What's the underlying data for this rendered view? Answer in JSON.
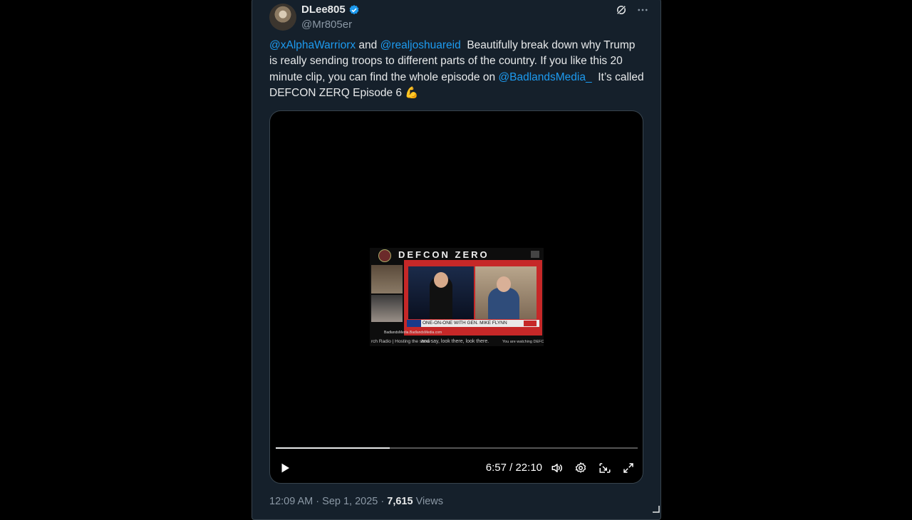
{
  "author": {
    "display_name": "DLee805",
    "handle": "@Mr805er"
  },
  "tweet": {
    "mention_1": "@xAlphaWarriorx",
    "and": " and ",
    "mention_2": "@realjoshuareid",
    "body_1": "  Beautifully break down why Trump is really sending troops to different parts of the country. If you like this 20 minute clip, you can find the whole episode on ",
    "mention_3": "@BadlandsMedia_",
    "body_2": "  It’s called DEFCON ZERQ Episode 6 ",
    "emoji": "💪"
  },
  "video": {
    "thumbnail_title": "DEFCON ZERO",
    "lower_third": "ONE-ON-ONE WITH GEN. MIKE FLYNN",
    "ticker_left": "rch Radio | Hosting the show",
    "ticker_mid": "and say, look there, look there.",
    "ticker_right": "You are watching DEFCON ZERO",
    "watermark": "BadlandsMedia.BadlandsMedia.com",
    "current_time": "6:57",
    "duration": "22:10",
    "time_display": "6:57 / 22:10",
    "progress_fraction": 0.314
  },
  "meta": {
    "time": "12:09 AM",
    "separator": " · ",
    "date": "Sep 1, 2025",
    "views_count": "7,615",
    "views_label": " Views"
  },
  "colors": {
    "card_bg": "#15202b",
    "accent": "#1d9bf0",
    "muted": "#8b98a5"
  },
  "icons": [
    "verified-badge-icon",
    "grok-icon",
    "more-icon",
    "play-icon",
    "volume-icon",
    "settings-icon",
    "pip-icon",
    "fullscreen-icon"
  ]
}
